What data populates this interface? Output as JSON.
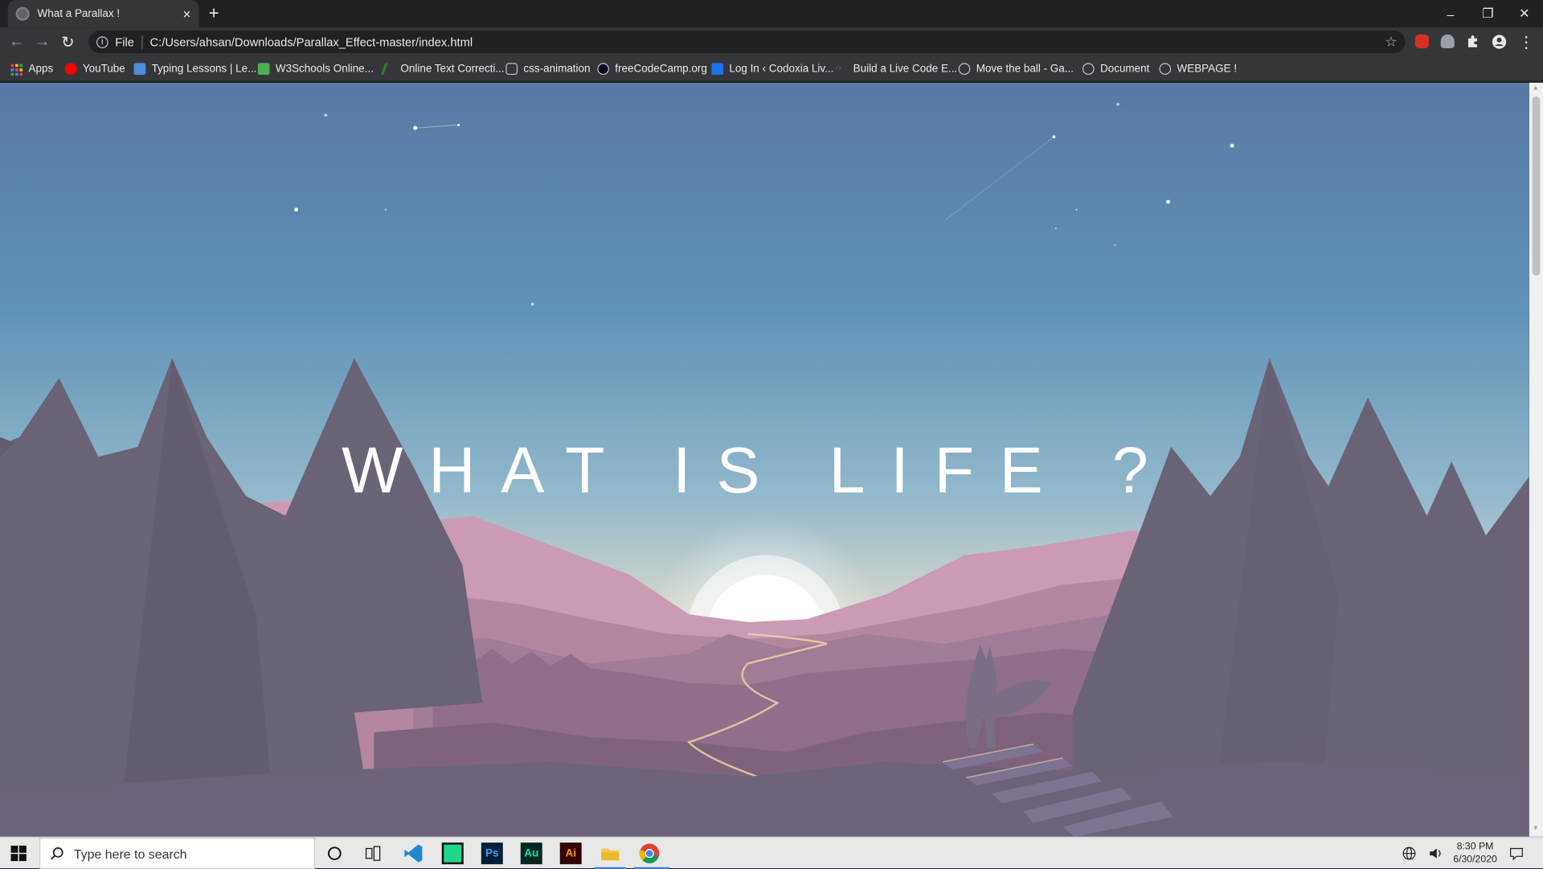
{
  "browser": {
    "tab_title": "What a Parallax !",
    "tab_close": "×",
    "new_tab": "+",
    "window_controls": {
      "minimize": "–",
      "restore": "❐",
      "close": "✕"
    },
    "nav": {
      "back": "←",
      "forward": "→",
      "reload": "↻"
    },
    "address": {
      "scheme_label": "File",
      "url": "C:/Users/ahsan/Downloads/Parallax_Effect-master/index.html",
      "star": "☆"
    },
    "menu": "⋮"
  },
  "bookmarks": [
    {
      "label": "Apps",
      "icon": "apps-grid-icon",
      "color": "#e8eaed"
    },
    {
      "label": "YouTube",
      "icon": "youtube-icon",
      "color": "#ff0000"
    },
    {
      "label": "Typing Lessons | Le...",
      "icon": "typing-icon",
      "color": "#4a90d9"
    },
    {
      "label": "W3Schools Online...",
      "icon": "w3schools-icon",
      "color": "#4caf50"
    },
    {
      "label": "Online Text Correcti...",
      "icon": "pen-icon",
      "color": "#2e7d32"
    },
    {
      "label": "css-animation",
      "icon": "css-icon",
      "color": "#bdc1c6"
    },
    {
      "label": "freeCodeCamp.org",
      "icon": "fcc-icon",
      "color": "#0a0a23"
    },
    {
      "label": "Log In ‹ Codoxia Liv...",
      "icon": "codoxia-icon",
      "color": "#1a73e8"
    },
    {
      "label": "Build a Live Code E...",
      "icon": "code-icon",
      "color": "#5f6368"
    },
    {
      "label": "Move the ball - Ga...",
      "icon": "globe-icon",
      "color": "#bdc1c6"
    },
    {
      "label": "Document",
      "icon": "globe-icon",
      "color": "#bdc1c6"
    },
    {
      "label": "WEBPAGE !",
      "icon": "globe-icon",
      "color": "#bdc1c6"
    }
  ],
  "page": {
    "headline": "WHAT IS LIFE ?",
    "colors": {
      "sky_top": "#5a7ea8",
      "sky_mid": "#6fa0c0",
      "horizon": "#f3dcc4",
      "trees": "#6b6275",
      "mountains": "#b88aa5"
    }
  },
  "taskbar": {
    "search_placeholder": "Type here to search",
    "apps": [
      "cortana-icon",
      "task-view-icon",
      "vscode-icon",
      "pycharm-icon",
      "photoshop-icon",
      "audition-icon",
      "illustrator-icon",
      "file-explorer-icon",
      "chrome-icon"
    ],
    "time": "8:30 PM",
    "date": "6/30/2020"
  }
}
